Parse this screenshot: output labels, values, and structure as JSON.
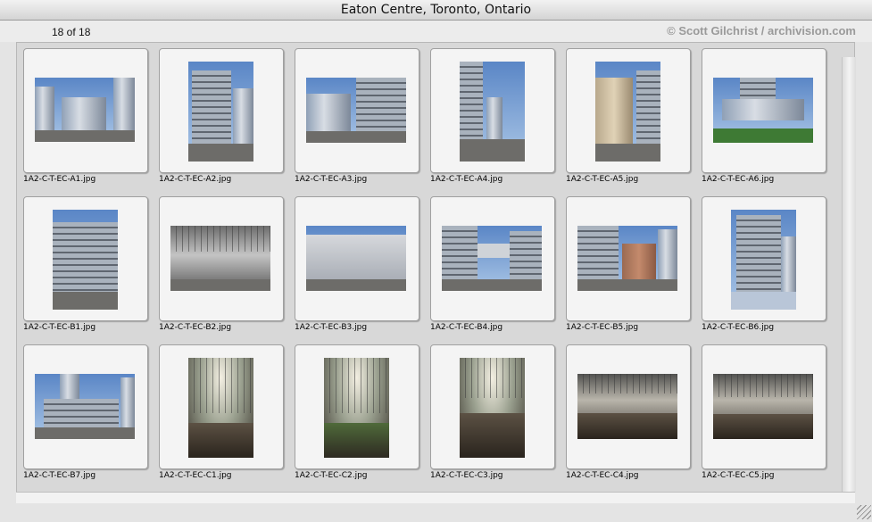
{
  "window": {
    "title": "Eaton Centre, Toronto, Ontario"
  },
  "info": {
    "count": "18 of 18",
    "copyright": "© Scott Gilchrist / archivision.com"
  },
  "thumbnails": [
    {
      "filename": "1A2-C-T-EC-A1.jpg"
    },
    {
      "filename": "1A2-C-T-EC-A2.jpg"
    },
    {
      "filename": "1A2-C-T-EC-A3.jpg"
    },
    {
      "filename": "1A2-C-T-EC-A4.jpg"
    },
    {
      "filename": "1A2-C-T-EC-A5.jpg"
    },
    {
      "filename": "1A2-C-T-EC-A6.jpg"
    },
    {
      "filename": "1A2-C-T-EC-B1.jpg"
    },
    {
      "filename": "1A2-C-T-EC-B2.jpg"
    },
    {
      "filename": "1A2-C-T-EC-B3.jpg"
    },
    {
      "filename": "1A2-C-T-EC-B4.jpg"
    },
    {
      "filename": "1A2-C-T-EC-B5.jpg"
    },
    {
      "filename": "1A2-C-T-EC-B6.jpg"
    },
    {
      "filename": "1A2-C-T-EC-B7.jpg"
    },
    {
      "filename": "1A2-C-T-EC-C1.jpg"
    },
    {
      "filename": "1A2-C-T-EC-C2.jpg"
    },
    {
      "filename": "1A2-C-T-EC-C3.jpg"
    },
    {
      "filename": "1A2-C-T-EC-C4.jpg"
    },
    {
      "filename": "1A2-C-T-EC-C5.jpg"
    }
  ]
}
